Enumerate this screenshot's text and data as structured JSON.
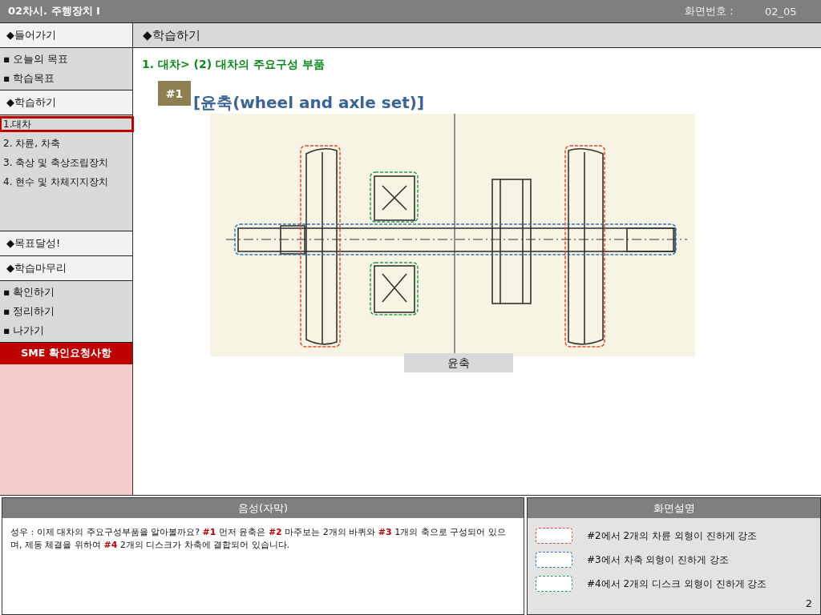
{
  "header": {
    "title": "02차시. 주행장치 Ⅰ",
    "screen_label": "화면번호 :",
    "screen_number": "02_05"
  },
  "sidebar": [
    {
      "kind": "heading",
      "label": "◆들어가기"
    },
    {
      "kind": "list",
      "items": [
        {
          "label": "▪ 오늘의 목표"
        },
        {
          "label": "▪ 학습목표"
        }
      ]
    },
    {
      "kind": "heading",
      "label": "◆학습하기"
    },
    {
      "kind": "nav",
      "items": [
        {
          "label": "1.대차",
          "selected": true
        },
        {
          "label": "2. 차륜, 차축",
          "selected": false
        },
        {
          "label": "3. 축상 및 축상조립장치",
          "selected": false
        },
        {
          "label": "4. 현수 및 차체지지장치",
          "selected": false
        }
      ]
    },
    {
      "kind": "heading",
      "label": "◆목표달성!"
    },
    {
      "kind": "heading",
      "label": "◆학습마무리"
    },
    {
      "kind": "list",
      "items": [
        {
          "label": "▪ 확인하기"
        },
        {
          "label": "▪ 정리하기"
        },
        {
          "label": "▪ 나가기"
        }
      ]
    },
    {
      "kind": "alert",
      "label": "SME 확인요청사항"
    }
  ],
  "main": {
    "heading": "◆학습하기",
    "subtitle": "1. 대차> (2) 대차의 주요구성 부품",
    "badge": "#1",
    "title": "[윤축(wheel and axle set)]",
    "caption": "윤축"
  },
  "narration": {
    "heading": "음성(자막)",
    "text": "성우 : 이제 대차의 주요구성부품을 알아볼까요? **#1** 먼저 윤축은 **#2** 마주보는 2개의 바퀴와 **#3** 1개의 축으로 구성되어 있으며, 제동 체결을 위하여 **#4** 2개의 디스크가 차축에 결합되어 있습니다."
  },
  "description": {
    "heading": "화면설명",
    "items": [
      {
        "label": "#2에서 2개의 차륜 외형이 진하게 강조",
        "color": "#e8452c"
      },
      {
        "label": "#3에서 차축 외형이 진하게 강조",
        "color": "#2e75b6"
      },
      {
        "label": "#4에서 2개의 디스크 외형이 진하게 강조",
        "color": "#22a050"
      }
    ],
    "page": "2"
  }
}
